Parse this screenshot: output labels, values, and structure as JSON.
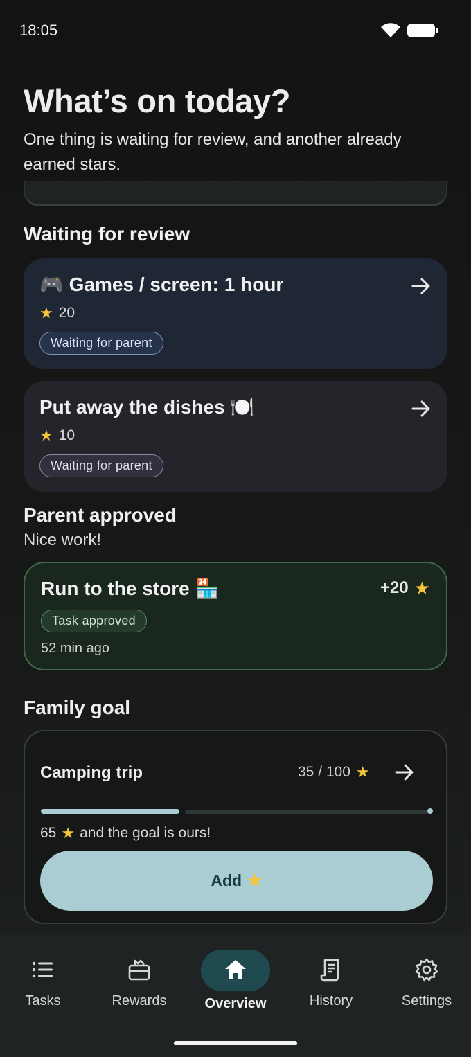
{
  "status_bar": {
    "time": "18:05"
  },
  "header": {
    "title": "What’s on today?",
    "subtitle": "One thing is waiting for review, and another already earned stars."
  },
  "review_section": {
    "title": "Waiting for review",
    "tasks": [
      {
        "title": "🎮 Games / screen: 1 hour",
        "stars": "20",
        "status": "Waiting for parent"
      },
      {
        "title": "Put away the dishes 🍽️",
        "stars": "10",
        "status": "Waiting for parent"
      }
    ]
  },
  "approved_section": {
    "title": "Parent approved",
    "subtitle": "Nice work!",
    "task": {
      "title": "Run to the store 🏪",
      "reward": "+20",
      "status": "Task approved",
      "time": "52 min ago"
    }
  },
  "goal_section": {
    "title": "Family goal",
    "goal": {
      "name": "Camping trip",
      "progress_text": "35 / 100",
      "current": 35,
      "target": 100,
      "remaining_text_pre": "65",
      "remaining_text_post": "and the goal is ours!",
      "add_label": "Add"
    }
  },
  "nav": {
    "items": [
      {
        "label": "Tasks",
        "icon": "list-icon"
      },
      {
        "label": "Rewards",
        "icon": "gift-box-icon"
      },
      {
        "label": "Overview",
        "icon": "home-icon",
        "active": true
      },
      {
        "label": "History",
        "icon": "receipt-icon"
      },
      {
        "label": "Settings",
        "icon": "gear-icon"
      }
    ]
  },
  "colors": {
    "accent": "#A9CDD2",
    "star": "#F6C43A",
    "review_card_1": "#1E2733",
    "review_card_2": "#25242B",
    "approved_card": "#1A271F",
    "nav_active": "#1E4A50"
  }
}
